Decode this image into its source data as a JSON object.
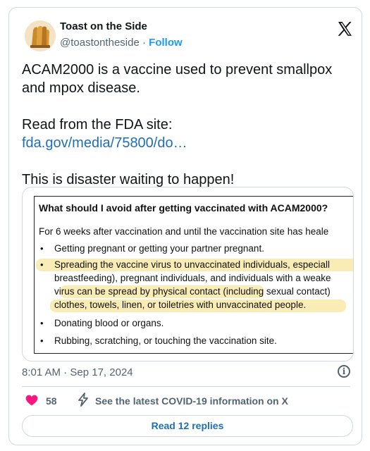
{
  "author": {
    "name": "Toast on the Side",
    "handle": "@toastontheside",
    "separator": "·",
    "follow_label": "Follow"
  },
  "tweet": {
    "line1": "ACAM2000 is a vaccine used to prevent smallpox",
    "line2": "and mpox disease.",
    "read_from": "Read from the FDA site:",
    "link": "fda.gov/media/75800/do…",
    "closing": "This is disaster waiting to happen!"
  },
  "document": {
    "title": "What should I avoid after getting vaccinated with ACAM2000?",
    "intro": "For 6 weeks after vaccination and until the vaccination site has heale",
    "bullets": [
      [
        "Getting pregnant or getting your partner pregnant."
      ],
      [
        "Spreading the vaccine virus to unvaccinated individuals, especiall",
        "breastfeeding), pregnant individuals, and individuals with a weake",
        "virus can be spread by physical contact (including sexual contact)",
        "clothes, towels, linen, or toiletries with unvaccinated people."
      ],
      [
        "Donating blood or organs."
      ],
      [
        "Rubbing, scratching, or touching the vaccination site."
      ]
    ],
    "bullet_char": "•",
    "highlight_color": "#f7e79c"
  },
  "meta": {
    "time": "8:01 AM",
    "separator": "·",
    "date": "Sep 17, 2024",
    "info_glyph": "i"
  },
  "actions": {
    "likes": "58",
    "covid_label": "See the latest COVID-19 information on X",
    "replies_label": "Read 12 replies"
  },
  "colors": {
    "link": "#1d6fb8",
    "heart": "#f91880",
    "muted": "#536471",
    "border": "#cfd9de"
  },
  "icons": {
    "logo": "x-logo-icon",
    "like": "heart-icon",
    "notice": "lightning-bolt-icon",
    "info": "info-icon"
  }
}
